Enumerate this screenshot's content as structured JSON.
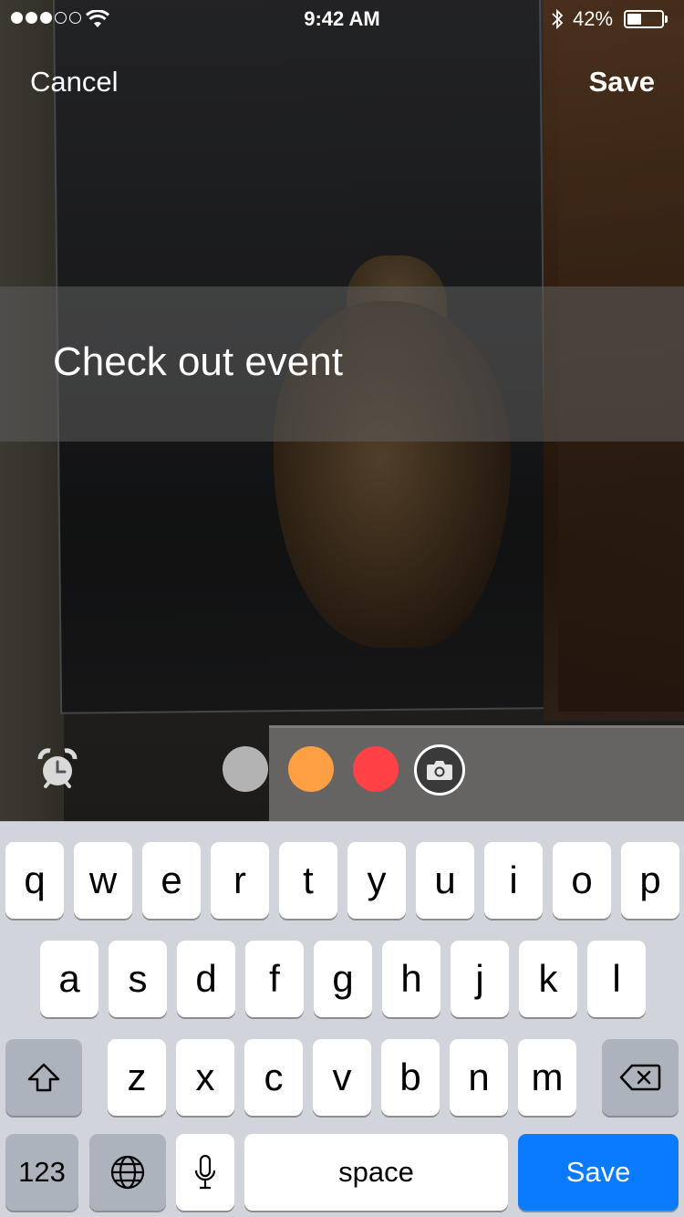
{
  "status_bar": {
    "time": "9:42 AM",
    "battery_percent": "42%",
    "battery_level": 0.42
  },
  "nav": {
    "cancel_label": "Cancel",
    "save_label": "Save"
  },
  "caption": {
    "text": "Check out event"
  },
  "toolbar": {
    "alarm_icon": "alarm-clock-icon",
    "camera_icon": "camera-icon",
    "colors": [
      {
        "name": "gray",
        "hex": "#b3b3b3"
      },
      {
        "name": "orange",
        "hex": "#ff9f43"
      },
      {
        "name": "red",
        "hex": "#ff4245"
      }
    ]
  },
  "keyboard": {
    "row1": [
      "q",
      "w",
      "e",
      "r",
      "t",
      "y",
      "u",
      "i",
      "o",
      "p"
    ],
    "row2": [
      "a",
      "s",
      "d",
      "f",
      "g",
      "h",
      "j",
      "k",
      "l"
    ],
    "row3": [
      "z",
      "x",
      "c",
      "v",
      "b",
      "n",
      "m"
    ],
    "numbers_label": "123",
    "space_label": "space",
    "return_label": "Save",
    "icons": [
      "shift-icon",
      "delete-icon",
      "globe-icon",
      "microphone-icon"
    ]
  }
}
